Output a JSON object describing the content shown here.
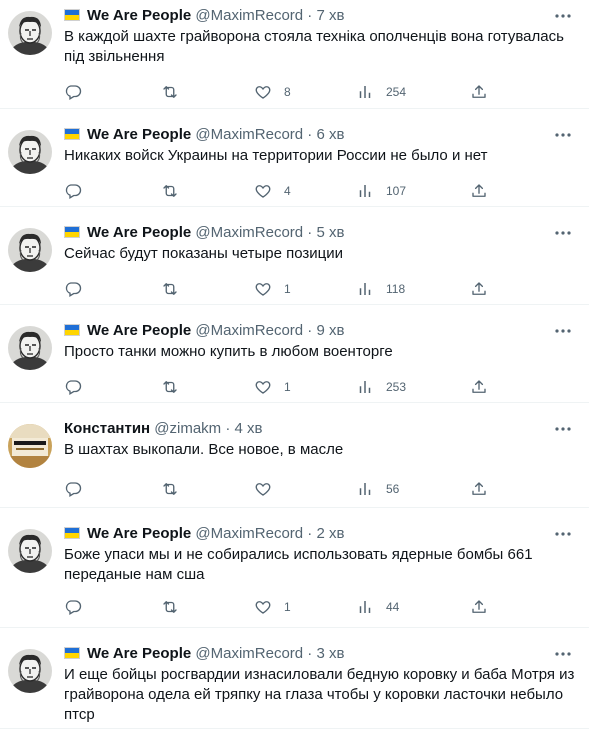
{
  "tweets": [
    {
      "name": "We Are People",
      "handle": "@MaximRecord",
      "time": "7 хв",
      "text": "В каждой шахте грайворона стояла техніка ополченців вона готувалась під звільнення",
      "likes": "8",
      "views": "254",
      "flag": true,
      "avatar": "portrait"
    },
    {
      "name": "We Are People",
      "handle": "@MaximRecord",
      "time": "6 хв",
      "text": "Никаких войск Украины на территории России не было и нет",
      "likes": "4",
      "views": "107",
      "flag": true,
      "avatar": "portrait"
    },
    {
      "name": "We Are People",
      "handle": "@MaximRecord",
      "time": "5 хв",
      "text": "Сейчас будут показаны четыре позиции",
      "likes": "1",
      "views": "118",
      "flag": true,
      "avatar": "portrait"
    },
    {
      "name": "We Are People",
      "handle": "@MaximRecord",
      "time": "9 хв",
      "text": "Просто танки можно купить в любом военторге",
      "likes": "1",
      "views": "253",
      "flag": true,
      "avatar": "portrait"
    },
    {
      "name": "Константин",
      "handle": "@zimakm",
      "time": "4 хв",
      "text": "В шахтах выкопали. Все новое, в масле",
      "likes": "",
      "views": "56",
      "flag": false,
      "avatar": "bottle"
    },
    {
      "name": "We Are People",
      "handle": "@MaximRecord",
      "time": "2 хв",
      "text": "Боже упаси мы и не собирались использовать ядерные бомбы 661 переданые нам сша",
      "likes": "1",
      "views": "44",
      "flag": true,
      "avatar": "portrait"
    },
    {
      "name": "We Are People",
      "handle": "@MaximRecord",
      "time": "3 хв",
      "text": "И еще бойцы росгвардии изнасиловали бедную коровку и баба Мотря из грайворона одела ей тряпку на глаза чтобы у коровки ласточки небыло птср",
      "likes": "",
      "views": "",
      "flag": true,
      "avatar": "portrait"
    }
  ],
  "colors": {
    "text": "#0f1419",
    "muted": "#536471",
    "divider": "#eff3f4"
  }
}
